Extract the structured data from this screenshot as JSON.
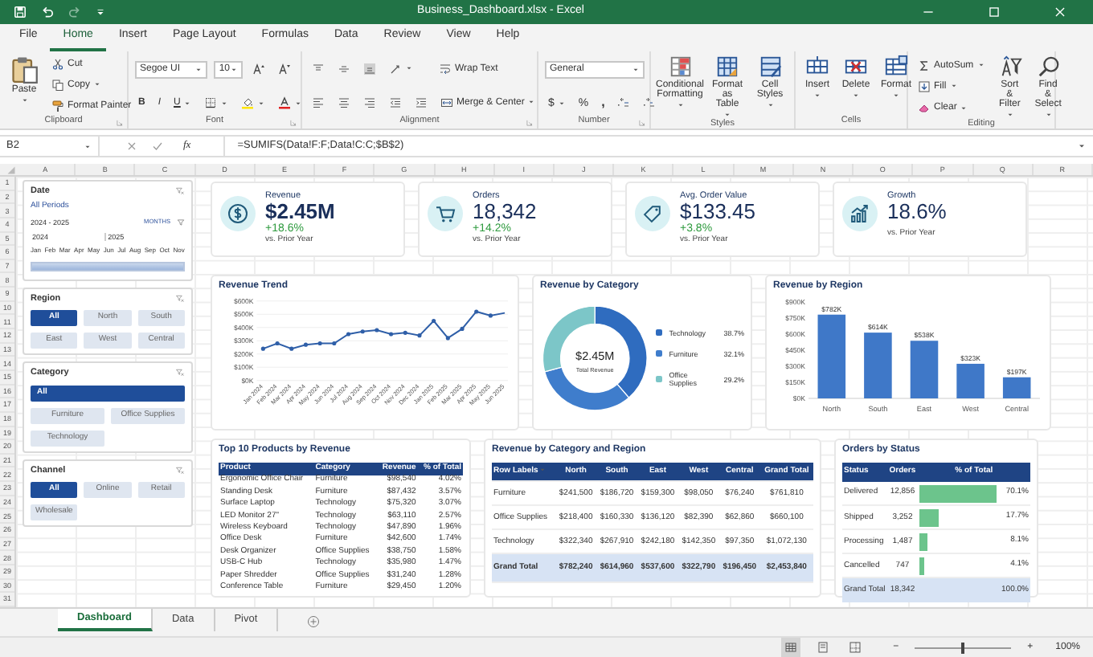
{
  "window": {
    "title": "Business_Dashboard.xlsx - Excel"
  },
  "ribbon_tabs": [
    {
      "label": "File",
      "selected": false
    },
    {
      "label": "Home",
      "selected": true
    },
    {
      "label": "Insert",
      "selected": false
    },
    {
      "label": "Page Layout",
      "selected": false
    },
    {
      "label": "Formulas",
      "selected": false
    },
    {
      "label": "Data",
      "selected": false
    },
    {
      "label": "Review",
      "selected": false
    },
    {
      "label": "View",
      "selected": false
    },
    {
      "label": "Help",
      "selected": false
    }
  ],
  "ribbon": {
    "clipboard": {
      "label": "Clipboard",
      "paste": "Paste",
      "cut": "Cut",
      "copy": "Copy",
      "format_painter": "Format Painter"
    },
    "font": {
      "label": "Font",
      "font_name": "Segoe UI",
      "font_size": "10",
      "bold": "B",
      "italic": "I",
      "underline": "U"
    },
    "alignment": {
      "label": "Alignment",
      "wrap_text": "Wrap Text",
      "merge": "Merge & Center"
    },
    "number": {
      "label": "Number",
      "format": "General",
      "currency": "$",
      "percent": "%",
      "comma": ","
    },
    "styles": {
      "label": "Styles",
      "buttons": [
        {
          "label": "Conditional Formatting",
          "kind": "conditional"
        },
        {
          "label": "Format as Table",
          "kind": "table"
        },
        {
          "label": "Cell Styles",
          "kind": "cellstyles"
        }
      ]
    },
    "cells": {
      "label": "Cells",
      "buttons": [
        {
          "label": "Insert",
          "kind": "insert"
        },
        {
          "label": "Delete",
          "kind": "delete"
        },
        {
          "label": "Format",
          "kind": "format"
        }
      ]
    },
    "editing": {
      "label": "Editing",
      "autosum": "AutoSum",
      "fill": "Fill",
      "clear": "Clear",
      "sort_filter": "Sort & Filter",
      "find_select": "Find & Select"
    }
  },
  "formula_bar": {
    "name_box": "B2",
    "function_label": "fx",
    "formula": "=SUMIFS(Data!F:F;Data!C:C;$B$2)"
  },
  "columns": [
    "A",
    "B",
    "C",
    "D",
    "E",
    "F",
    "G",
    "H",
    "I",
    "J",
    "K",
    "L",
    "M",
    "N",
    "O",
    "P",
    "Q",
    "R"
  ],
  "rows": [
    "1",
    "2",
    "3",
    "4",
    "5",
    "6",
    "7",
    "8",
    "9",
    "10",
    "11",
    "12",
    "13",
    "14",
    "15",
    "16",
    "17",
    "18",
    "19",
    "20",
    "21",
    "22",
    "23",
    "24",
    "25",
    "26",
    "27",
    "28",
    "29",
    "30",
    "31"
  ],
  "slicers": [
    {
      "title": "Date",
      "kind": "timeline",
      "filter": "All Periods",
      "range": "2024 - 2025",
      "unit": "MONTHS",
      "years": [
        "2024",
        "2025"
      ],
      "months": [
        "Jan",
        "Feb",
        "Mar",
        "Apr",
        "May",
        "Jun",
        "Jul",
        "Aug",
        "Sep",
        "Oct",
        "Nov"
      ]
    },
    {
      "title": "Region",
      "kind": "tiles",
      "options": [
        {
          "label": "All",
          "selected": true
        },
        {
          "label": "North",
          "selected": false
        },
        {
          "label": "South",
          "selected": false
        },
        {
          "label": "East",
          "selected": false
        },
        {
          "label": "West",
          "selected": false
        },
        {
          "label": "Central",
          "selected": false
        }
      ]
    },
    {
      "title": "Category",
      "kind": "banner",
      "options": [
        {
          "label": "All",
          "selected": true
        },
        {
          "label": "Furniture",
          "selected": false
        },
        {
          "label": "Office Supplies",
          "selected": false
        },
        {
          "label": "Technology",
          "selected": false
        }
      ]
    },
    {
      "title": "Channel",
      "kind": "tiles",
      "options": [
        {
          "label": "All",
          "selected": true
        },
        {
          "label": "Online",
          "selected": false
        },
        {
          "label": "Retail",
          "selected": false
        },
        {
          "label": "Wholesale",
          "selected": false
        }
      ]
    }
  ],
  "kpis": [
    {
      "kind": "dollar",
      "label": "Revenue",
      "value": "$2.45M",
      "bold": true,
      "change": "+18.6%",
      "note": "vs. Prior Year"
    },
    {
      "kind": "cart",
      "label": "Orders",
      "value": "18,342",
      "bold": false,
      "change": "+14.2%",
      "note": "vs. Prior Year"
    },
    {
      "kind": "tag",
      "label": "Avg. Order Value",
      "value": "$133.45",
      "bold": false,
      "change": "+3.8%",
      "note": "vs. Prior Year"
    },
    {
      "kind": "growth",
      "label": "Growth",
      "value": "18.6%",
      "bold": false,
      "note": "vs. Prior Year"
    }
  ],
  "charts": [
    {
      "title": "Revenue Trend",
      "chart_data": {
        "type": "line",
        "categories": [
          "Jan 2024",
          "Feb 2024",
          "Mar 2024",
          "Apr 2024",
          "May 2024",
          "Jun 2024",
          "Jul 2024",
          "Aug 2024",
          "Sep 2024",
          "Oct 2024",
          "Nov 2024",
          "Dec 2024",
          "Jan 2025",
          "Feb 2025",
          "Mar 2025",
          "Apr 2025",
          "May 2025",
          "Jun 2025"
        ],
        "series": [
          {
            "color": "#2f5fa8",
            "values": [
              240,
              280,
              240,
              270,
              280,
              280,
              350,
              370,
              380,
              350,
              360,
              340,
              450,
              320,
              390,
              520,
              490,
              510
            ]
          }
        ],
        "ylim": [
          0,
          600
        ],
        "grid": true,
        "yticks": [
          {
            "value": 0,
            "label": "$0K"
          },
          {
            "value": 100,
            "label": "$100K"
          },
          {
            "value": 200,
            "label": "$200K"
          },
          {
            "value": 300,
            "label": "$300K"
          },
          {
            "value": 400,
            "label": "$400K"
          },
          {
            "value": 500,
            "label": "$500K"
          },
          {
            "value": 600,
            "label": "$600K"
          }
        ]
      }
    },
    {
      "title": "Revenue by Category",
      "center_value": "$2.45M",
      "center_label": "Total Revenue",
      "slices": [
        {
          "value_label": "38.7%",
          "color": "#2f6cbf"
        },
        {
          "value_label": "32.1%",
          "color": "#3f7dcc"
        },
        {
          "value_label": "29.2%",
          "color": "#7cc6c8"
        }
      ],
      "chart_data": {
        "type": "donut",
        "categories": [
          "Technology",
          "Furniture",
          "Office Supplies"
        ],
        "series": [
          {
            "values": [
              38.7,
              32.1,
              29.2
            ]
          }
        ],
        "legend": "right"
      }
    },
    {
      "title": "Revenue by Region",
      "chart_data": {
        "type": "bar",
        "categories": [
          "North",
          "South",
          "East",
          "West",
          "Central"
        ],
        "series": [
          {
            "color": "#3f78c8",
            "values": [
              782,
              614,
              538,
              323,
              197
            ]
          }
        ],
        "ylim": [
          0,
          900
        ],
        "yticks": [
          {
            "value": 0,
            "label": "$0K"
          },
          {
            "value": 150,
            "label": "$150K"
          },
          {
            "value": 300,
            "label": "$300K"
          },
          {
            "value": 450,
            "label": "$450K"
          },
          {
            "value": 600,
            "label": "$600K"
          },
          {
            "value": 750,
            "label": "$750K"
          },
          {
            "value": 900,
            "label": "$900K"
          }
        ],
        "value_labels": [
          "$782K",
          "$614K",
          "$538K",
          "$323K",
          "$197K"
        ]
      }
    }
  ],
  "top_products": {
    "title": "Top 10 Products by Revenue",
    "columns": [
      "Product",
      "Category",
      "Revenue",
      "% of Total"
    ],
    "rows": [
      [
        "Ergonomic Office Chair",
        "Furniture",
        "$98,540",
        "4.02%"
      ],
      [
        "Standing Desk",
        "Furniture",
        "$87,432",
        "3.57%"
      ],
      [
        "Surface Laptop",
        "Technology",
        "$75,320",
        "3.07%"
      ],
      [
        "LED Monitor 27\"",
        "Technology",
        "$63,110",
        "2.57%"
      ],
      [
        "Wireless Keyboard",
        "Technology",
        "$47,890",
        "1.96%"
      ],
      [
        "Office Desk",
        "Furniture",
        "$42,600",
        "1.74%"
      ],
      [
        "Desk Organizer",
        "Office Supplies",
        "$38,750",
        "1.58%"
      ],
      [
        "USB-C Hub",
        "Technology",
        "$35,980",
        "1.47%"
      ],
      [
        "Paper Shredder",
        "Office Supplies",
        "$31,240",
        "1.28%"
      ],
      [
        "Conference Table",
        "Furniture",
        "$29,450",
        "1.20%"
      ]
    ]
  },
  "category_region": {
    "title": "Revenue by Category and Region",
    "columns": [
      "Row Labels",
      "North",
      "South",
      "East",
      "West",
      "Central",
      "Grand Total"
    ],
    "rows": [
      [
        "Furniture",
        "$241,500",
        "$186,720",
        "$159,300",
        "$98,050",
        "$76,240",
        "$761,810"
      ],
      [
        "Office Supplies",
        "$218,400",
        "$160,330",
        "$136,120",
        "$82,390",
        "$62,860",
        "$660,100"
      ],
      [
        "Technology",
        "$322,340",
        "$267,910",
        "$242,180",
        "$142,350",
        "$97,350",
        "$1,072,130"
      ]
    ],
    "total": [
      "Grand Total",
      "$782,240",
      "$614,960",
      "$537,600",
      "$322,790",
      "$196,450",
      "$2,453,840"
    ]
  },
  "orders_status": {
    "title": "Orders by Status",
    "columns": [
      "Status",
      "Orders",
      "% of Total"
    ],
    "rows": [
      {
        "status": "Delivered",
        "orders": "12,856",
        "share": "70.1%",
        "level": 0.701
      },
      {
        "status": "Shipped",
        "orders": "3,252",
        "share": "17.7%",
        "level": 0.177
      },
      {
        "status": "Processing",
        "orders": "1,487",
        "share": "8.1%",
        "level": 0.081
      },
      {
        "status": "Cancelled",
        "orders": "747",
        "share": "4.1%",
        "level": 0.041
      }
    ],
    "total": [
      "Grand Total",
      "18,342",
      "100.0%"
    ]
  },
  "sheet_tabs": [
    {
      "label": "Dashboard",
      "selected": true
    },
    {
      "label": "Data",
      "selected": false
    },
    {
      "label": "Pivot",
      "selected": false
    }
  ],
  "status_bar": {
    "views": [
      {
        "kind": "normal",
        "selected": true
      },
      {
        "kind": "layout",
        "selected": false
      },
      {
        "kind": "pagebreak",
        "selected": false
      }
    ],
    "zoom_out": "−",
    "zoom_in": "+",
    "level": 0.5,
    "zoom": "100%"
  }
}
